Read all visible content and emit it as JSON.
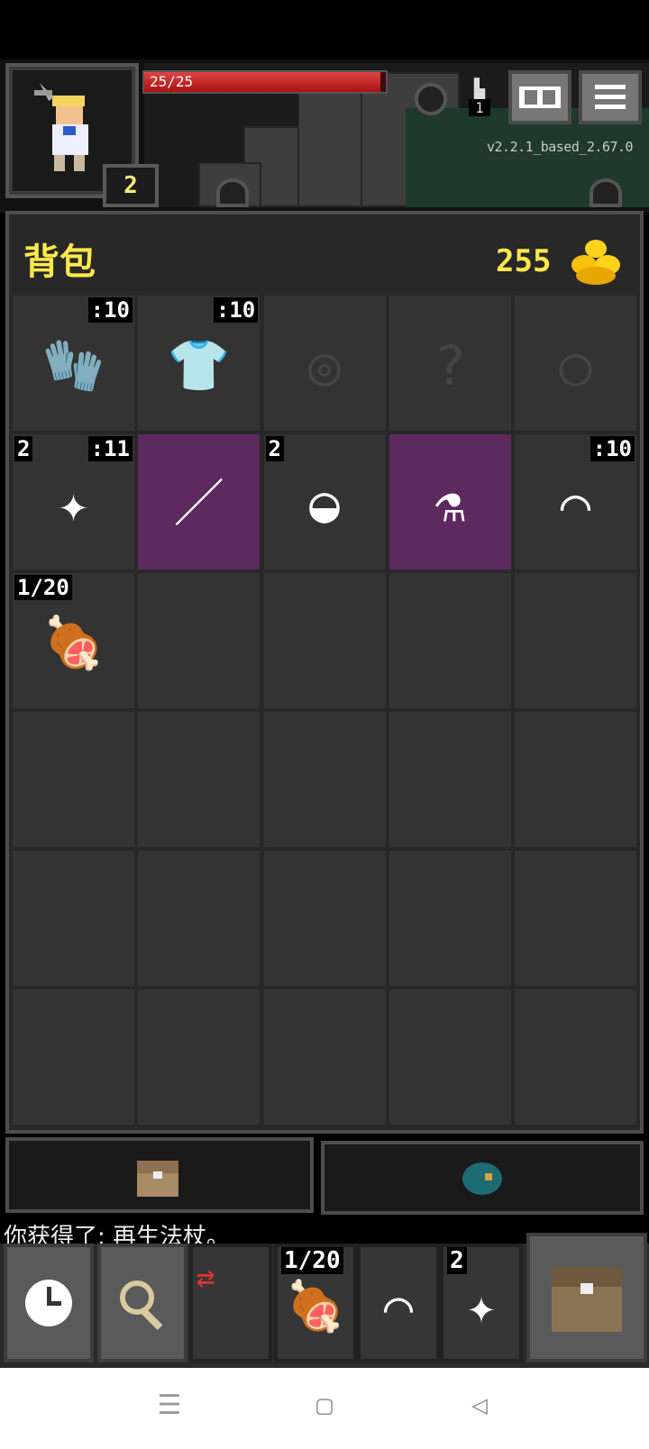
{
  "hud": {
    "hp_text": "25/25",
    "level": "2",
    "depth": "1",
    "version": "v2.2.1_based_2.67.0"
  },
  "backpack": {
    "title": "背包",
    "gold": "255",
    "slots": [
      {
        "name": "gloves",
        "icon": "🧤",
        "top_right": ":10",
        "empty": false
      },
      {
        "name": "cloth-armor",
        "icon": "👕",
        "top_right": ":10",
        "empty": false
      },
      {
        "name": "empty-weapon-slot",
        "icon": "◎",
        "empty": true
      },
      {
        "name": "empty-misc-slot",
        "icon": "?",
        "empty": true
      },
      {
        "name": "empty-ring-slot",
        "icon": "○",
        "empty": true
      },
      {
        "name": "shuriken",
        "icon": "✦",
        "top_left": "2",
        "top_right": ":11",
        "empty": false
      },
      {
        "name": "magic-wand",
        "icon": "／",
        "highlight": true,
        "empty": false
      },
      {
        "name": "stones",
        "icon": "◒",
        "top_left": "2",
        "empty": false
      },
      {
        "name": "potion",
        "icon": "⚗",
        "highlight": true,
        "empty": false
      },
      {
        "name": "bow",
        "icon": "⌒",
        "top_right": ":10",
        "empty": false
      },
      {
        "name": "meat",
        "icon": "🍖",
        "top_left": "1/20",
        "empty": false
      }
    ]
  },
  "log": {
    "text": "你获得了: 再生法杖。"
  },
  "quickslots": [
    {
      "name": "quickslot-meat",
      "icon": "🍖",
      "label": "1/20"
    },
    {
      "name": "quickslot-bow",
      "icon": "⌒",
      "label": ""
    },
    {
      "name": "quickslot-shuriken",
      "icon": "✦",
      "label": "2"
    }
  ],
  "colors": {
    "accent_yellow": "#ffe94a",
    "highlight_purple": "#5c2a5f",
    "hp_red": "#c62a2a"
  }
}
